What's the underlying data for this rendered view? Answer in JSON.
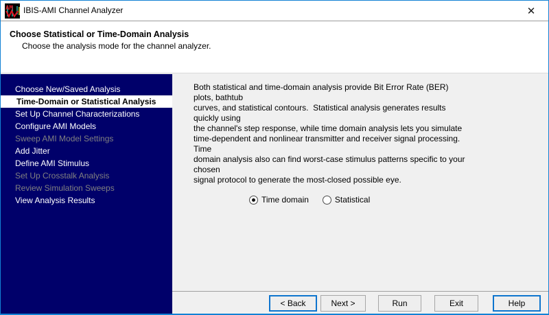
{
  "window": {
    "title": "IBIS-AMI Channel Analyzer",
    "close_glyph": "✕"
  },
  "header": {
    "title": "Choose Statistical or Time-Domain Analysis",
    "subtitle": "Choose the analysis mode for the channel analyzer."
  },
  "sidebar": {
    "items": [
      {
        "label": "Choose New/Saved Analysis",
        "state": "normal"
      },
      {
        "label": "Time-Domain or Statistical Analysis",
        "state": "selected"
      },
      {
        "label": "Set Up Channel Characterizations",
        "state": "normal"
      },
      {
        "label": "Configure AMI Models",
        "state": "normal"
      },
      {
        "label": "Sweep AMI Model Settings",
        "state": "disabled"
      },
      {
        "label": "Add Jitter",
        "state": "normal"
      },
      {
        "label": "Define AMI Stimulus",
        "state": "normal"
      },
      {
        "label": "Set Up Crosstalk Analysis",
        "state": "disabled"
      },
      {
        "label": "Review Simulation Sweeps",
        "state": "disabled"
      },
      {
        "label": "View Analysis Results",
        "state": "normal"
      }
    ]
  },
  "content": {
    "description": "Both statistical and time-domain analysis provide Bit Error Rate (BER) plots, bathtub\ncurves, and statistical contours.  Statistical analysis generates results quickly using\nthe channel's step response, while time domain analysis lets you simulate\ntime-dependent and nonlinear transmitter and receiver signal processing.  Time\ndomain analysis also can find worst-case stimulus patterns specific to your chosen\nsignal protocol to generate the most-closed possible eye.",
    "radio_options": [
      {
        "label": "Time domain",
        "selected": true
      },
      {
        "label": "Statistical",
        "selected": false
      }
    ]
  },
  "footer": {
    "buttons": [
      {
        "label": "< Back",
        "focused": true
      },
      {
        "label": "Next >",
        "focused": false
      },
      {
        "label": "Run",
        "focused": false
      },
      {
        "label": "Exit",
        "focused": false
      },
      {
        "label": "Help",
        "focused": true
      }
    ]
  },
  "colors": {
    "sidebar_bg": "#00006a",
    "accent_border": "#1182d4",
    "content_bg": "#f0f0f0",
    "focus_button_border": "#0d74ce"
  }
}
